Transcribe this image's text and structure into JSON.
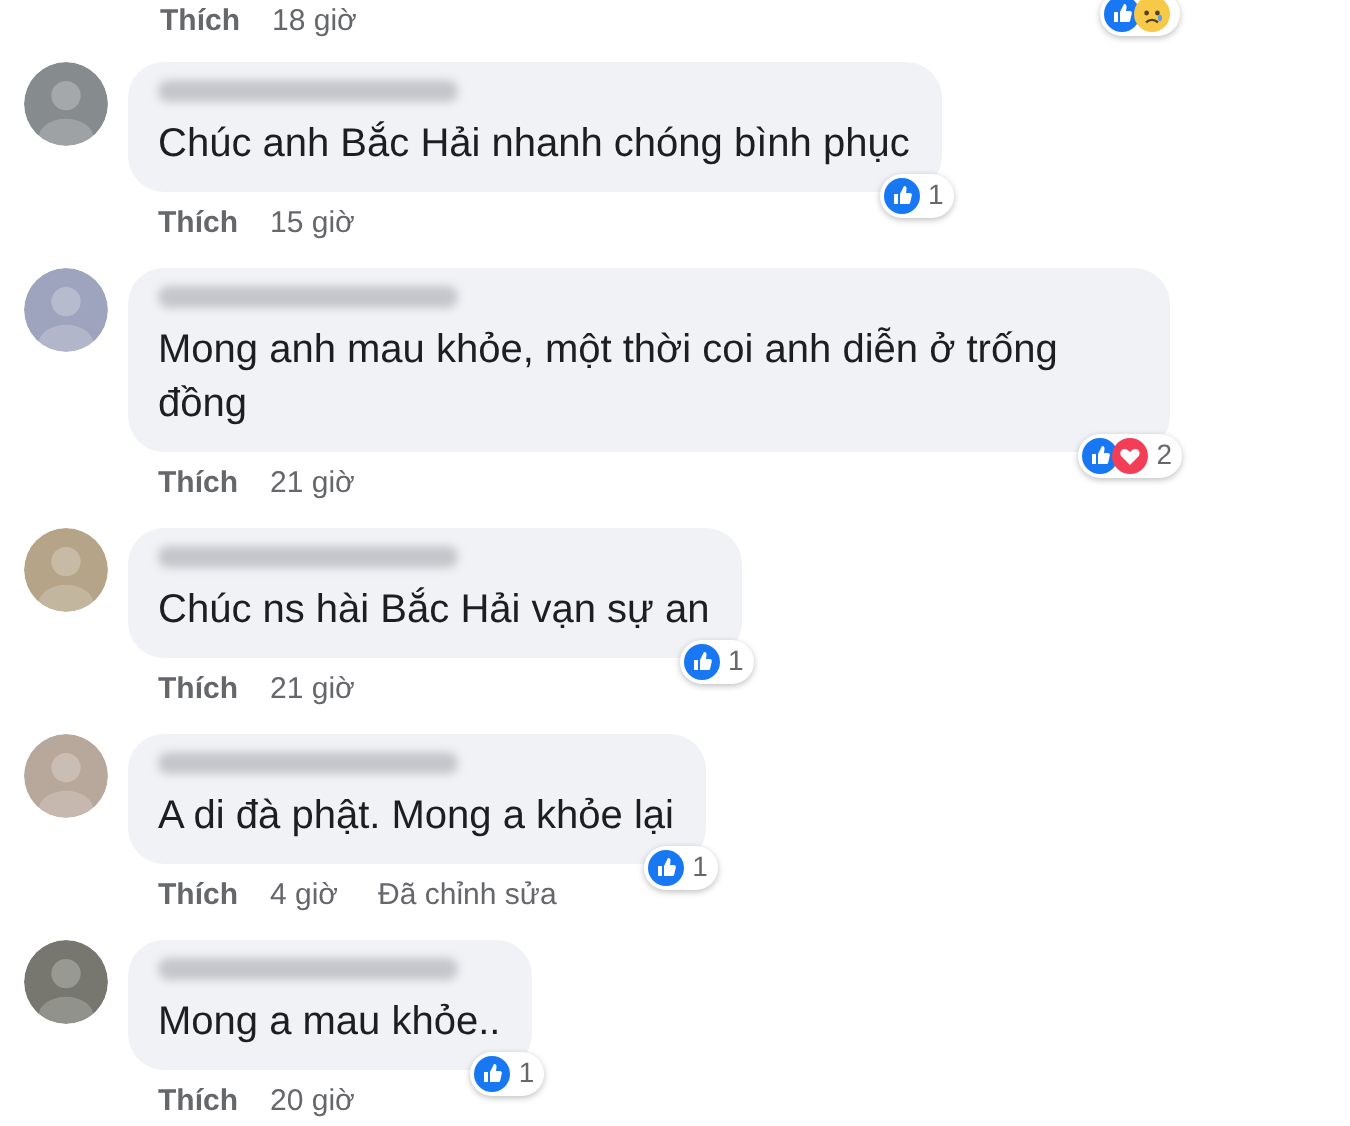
{
  "comments": [
    {
      "kind": "actions_only",
      "actions": {
        "like": "Thích",
        "time": "18 giờ"
      },
      "reactions": {
        "icons": [
          {
            "kind": "like"
          },
          {
            "kind": "sad"
          }
        ]
      }
    },
    {
      "kind": "full",
      "text": "Chúc anh Bắc Hải nhanh chóng bình phục",
      "actions": {
        "like": "Thích",
        "time": "15 giờ"
      },
      "reactions": {
        "icons": [
          {
            "kind": "like"
          }
        ],
        "count": "1"
      }
    },
    {
      "kind": "full",
      "text": "Mong anh mau khỏe, một thời coi anh diễn ở trống đồng",
      "actions": {
        "like": "Thích",
        "time": "21 giờ"
      },
      "reactions": {
        "icons": [
          {
            "kind": "like"
          },
          {
            "kind": "love"
          }
        ],
        "count": "2"
      }
    },
    {
      "kind": "full",
      "text": "Chúc ns hài Bắc Hải vạn sự an",
      "actions": {
        "like": "Thích",
        "time": "21 giờ"
      },
      "reactions": {
        "icons": [
          {
            "kind": "like"
          }
        ],
        "count": "1"
      }
    },
    {
      "kind": "full",
      "text": "A di đà phật. Mong a khỏe lại",
      "actions": {
        "like": "Thích",
        "time": "4 giờ",
        "edited": "Đã chỉnh sửa"
      },
      "reactions": {
        "icons": [
          {
            "kind": "like"
          }
        ],
        "count": "1"
      }
    },
    {
      "kind": "full",
      "text": "Mong a mau khỏe..",
      "actions": {
        "like": "Thích",
        "time": "20 giờ"
      },
      "reactions": {
        "icons": [
          {
            "kind": "like"
          }
        ],
        "count": "1"
      }
    },
    {
      "kind": "cut_off"
    }
  ]
}
